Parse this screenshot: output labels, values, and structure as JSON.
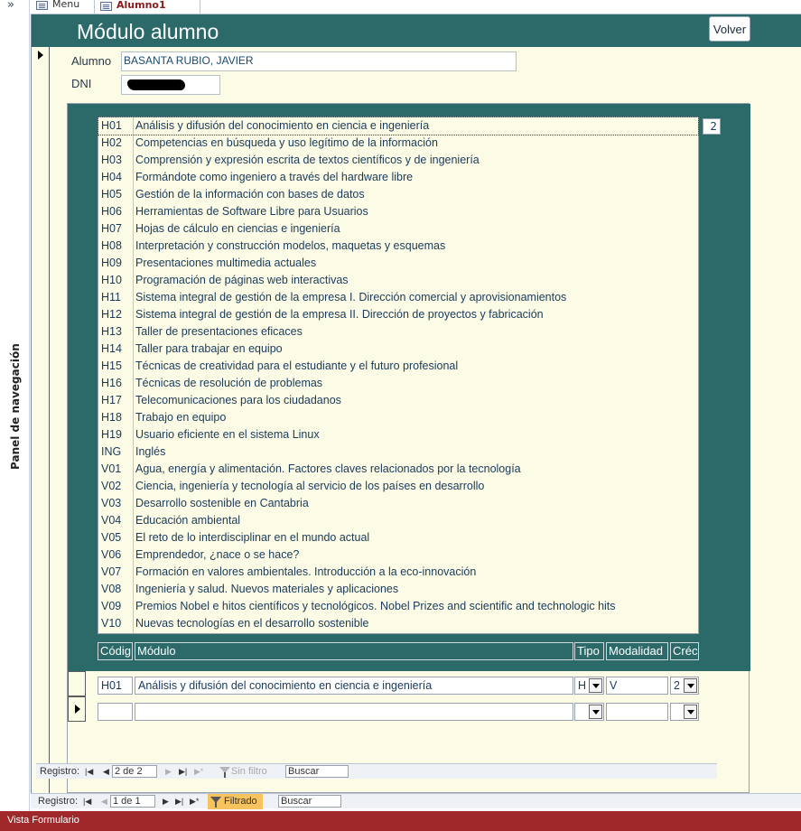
{
  "nav_pane": {
    "toggle_glyph": "»",
    "label": "Panel de navegación"
  },
  "tabs": [
    {
      "label": "Menu",
      "icon": "form-icon"
    },
    {
      "label": "Alumno1",
      "icon": "form-icon"
    }
  ],
  "header": {
    "title": "Módulo alumno",
    "back_button": "Volver"
  },
  "fields": {
    "alumno_label": "Alumno",
    "alumno_value": "BASANTA RUBIO, JAVIER",
    "dni_label": "DNI"
  },
  "listbox": {
    "count": "2",
    "items": [
      {
        "code": "H01",
        "name": "Análisis y difusión del conocimiento en ciencia e ingeniería"
      },
      {
        "code": "H02",
        "name": "Competencias en búsqueda y uso legítimo de la información"
      },
      {
        "code": "H03",
        "name": "Comprensión y expresión escrita de textos científicos y de ingeniería"
      },
      {
        "code": "H04",
        "name": "Formándote como ingeniero a través del hardware libre"
      },
      {
        "code": "H05",
        "name": "Gestión de la información con bases de datos"
      },
      {
        "code": "H06",
        "name": "Herramientas de Software Libre para Usuarios"
      },
      {
        "code": "H07",
        "name": "Hojas de cálculo en ciencias e ingeniería"
      },
      {
        "code": "H08",
        "name": "Interpretación y construcción modelos, maquetas y esquemas"
      },
      {
        "code": "H09",
        "name": "Presentaciones multimedia actuales"
      },
      {
        "code": "H10",
        "name": "Programación de páginas web interactivas"
      },
      {
        "code": "H11",
        "name": "Sistema integral de gestión de la empresa I. Dirección comercial y aprovisionamientos"
      },
      {
        "code": "H12",
        "name": "Sistema integral de gestión de la empresa II. Dirección de proyectos y fabricación"
      },
      {
        "code": "H13",
        "name": "Taller de presentaciones eficaces"
      },
      {
        "code": "H14",
        "name": "Taller para trabajar en equipo"
      },
      {
        "code": "H15",
        "name": "Técnicas de creatividad para el estudiante y el futuro profesional"
      },
      {
        "code": "H16",
        "name": "Técnicas de resolución de problemas"
      },
      {
        "code": "H17",
        "name": "Telecomunicaciones para los ciudadanos"
      },
      {
        "code": "H18",
        "name": "Trabajo en equipo"
      },
      {
        "code": "H19",
        "name": "Usuario eficiente en el sistema Linux"
      },
      {
        "code": "ING",
        "name": "Inglés"
      },
      {
        "code": "V01",
        "name": "Agua, energía y alimentación. Factores claves relacionados por la tecnología"
      },
      {
        "code": "V02",
        "name": "Ciencia, ingeniería y tecnología al servicio de los países en desarrollo"
      },
      {
        "code": "V03",
        "name": "Desarrollo sostenible en Cantabria"
      },
      {
        "code": "V04",
        "name": "Educación ambiental"
      },
      {
        "code": "V05",
        "name": "El reto de lo interdisciplinar en el mundo actual"
      },
      {
        "code": "V06",
        "name": "Emprendedor, ¿nace o se hace?"
      },
      {
        "code": "V07",
        "name": "Formación en valores ambientales. Introducción a la eco-innovación"
      },
      {
        "code": "V08",
        "name": "Ingeniería y salud. Nuevos materiales y aplicaciones"
      },
      {
        "code": "V09",
        "name": "Premios Nobel e hitos científicos y tecnológicos. Nobel Prizes and scientific and technologic hits"
      },
      {
        "code": "V10",
        "name": "Nuevas tecnologías en el desarrollo sostenible"
      }
    ]
  },
  "grid": {
    "columns": {
      "codigo": "Códig",
      "modulo": "Módulo",
      "tipo": "Tipo",
      "modalidad": "Modalidad",
      "creditos": "Créc"
    },
    "rows": [
      {
        "codigo": "H01",
        "modulo": "Análisis y difusión del conocimiento en ciencia e ingeniería",
        "tipo": "H",
        "modalidad": "V",
        "creditos": "2"
      },
      {
        "codigo": "",
        "modulo": "",
        "tipo": "",
        "modalidad": "",
        "creditos": ""
      }
    ]
  },
  "subform_nav": {
    "label": "Registro:",
    "record": "2 de 2",
    "filter": "Sin filtro",
    "search": "Buscar"
  },
  "main_nav": {
    "label": "Registro:",
    "record": "1 de 1",
    "filter": "Filtrado",
    "search": "Buscar"
  },
  "status_bar": {
    "text": "Vista Formulario"
  },
  "colors": {
    "header_teal": "#2c6a6a",
    "form_bg": "#fcfce6",
    "status_red": "#a0282a",
    "filter_orange": "#f7c35f"
  }
}
